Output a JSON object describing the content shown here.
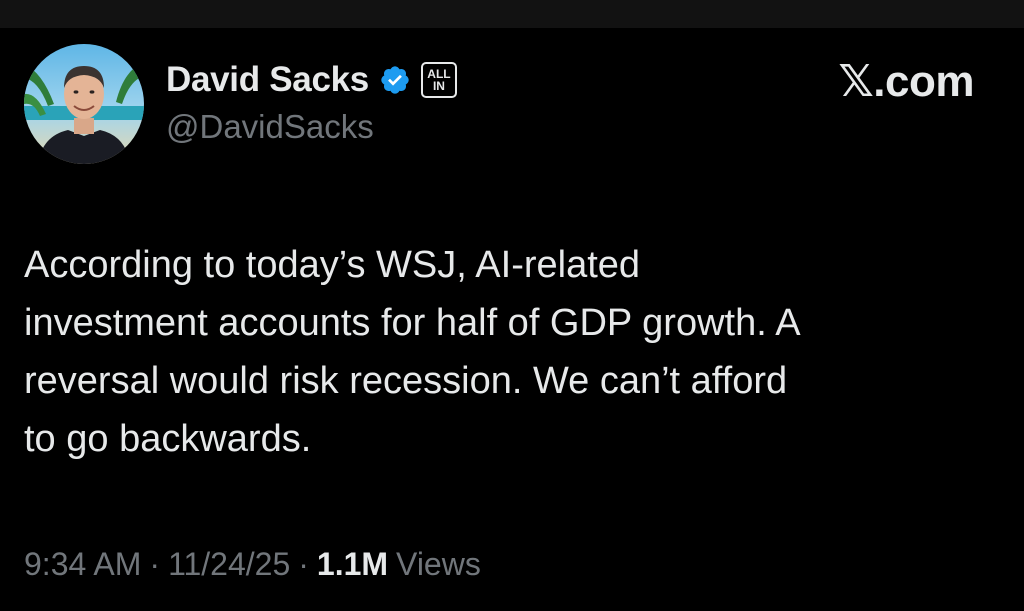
{
  "colors": {
    "background": "#000000",
    "text_primary": "#e7e9ea",
    "text_secondary": "#71767b",
    "verified_blue": "#1d9bf0"
  },
  "author": {
    "display_name": "David Sacks",
    "handle": "@DavidSacks",
    "verified_icon": "verified-badge-icon",
    "affiliation_badge": "ALL\nIN"
  },
  "brand": {
    "label": "𝕏.com"
  },
  "tweet": {
    "text": "According to today’s WSJ, AI-related\ninvestment accounts for half of GDP growth. A\nreversal would risk recession. We can’t afford\nto go backwards."
  },
  "meta": {
    "time": "9:34 AM",
    "separator": "·",
    "date": "11/24/25",
    "views_count": "1.1M",
    "views_label": "Views"
  }
}
